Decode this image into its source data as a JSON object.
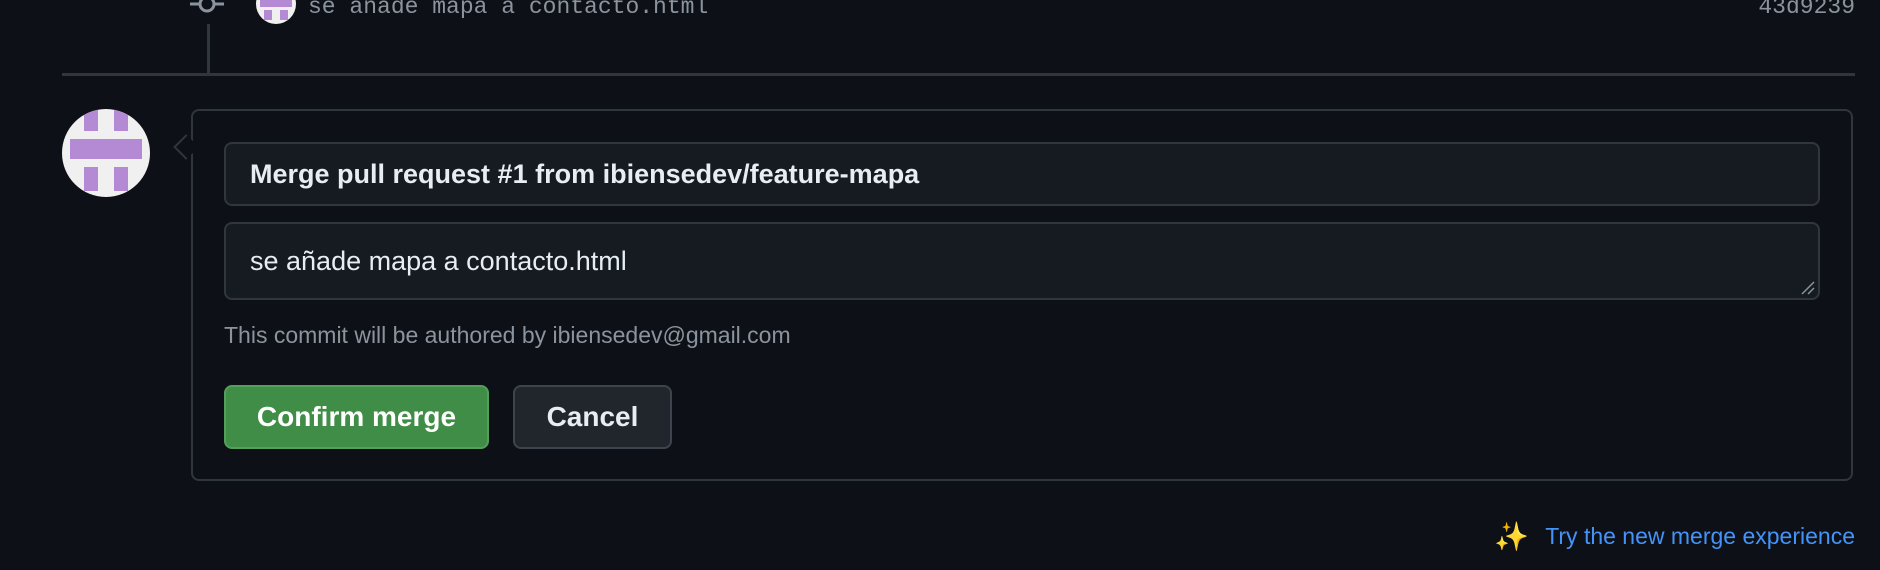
{
  "commit": {
    "message": "se añade mapa a contacto.html",
    "sha": "43d9239"
  },
  "merge": {
    "title_value": "Merge pull request #1 from ibiensedev/feature-mapa",
    "body_value": "se añade mapa a contacto.html",
    "author_note": "This commit will be authored by ibiensedev@gmail.com",
    "confirm_label": "Confirm merge",
    "cancel_label": "Cancel"
  },
  "footer": {
    "sparkle_icon": "sparkles-icon",
    "try_link_label": "Try the new merge experience"
  },
  "colors": {
    "background": "#0d1117",
    "border": "#30363d",
    "confirm_button": "#3f8d47",
    "link": "#4493f8",
    "avatar_identicon": "#b48ad4"
  }
}
